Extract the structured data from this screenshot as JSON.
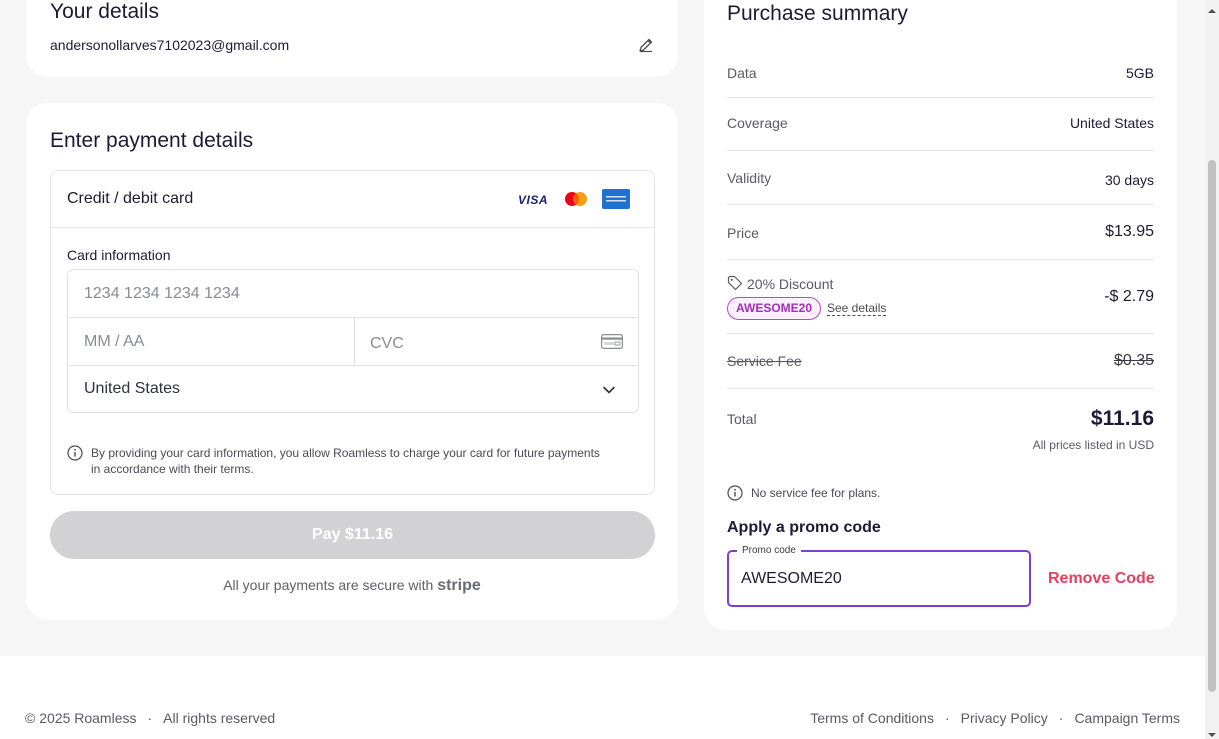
{
  "details": {
    "title": "Your details",
    "email": "andersonollarves7102023@gmail.com"
  },
  "payment": {
    "title": "Enter payment details",
    "method_label": "Credit / debit card",
    "card_brands": [
      "VISA",
      "mastercard",
      "amex"
    ],
    "card_info_label": "Card information",
    "card_number_placeholder": "1234 1234 1234 1234",
    "expiry_placeholder": "MM / AA",
    "cvc_placeholder": "CVC",
    "country_value": "United States",
    "consent_text": "By providing your card information, you allow Roamless to charge your card for future payments in accordance with their terms.",
    "pay_button_label": "Pay $11.16",
    "secure_text": "All your payments are secure with",
    "secure_brand": "stripe"
  },
  "summary": {
    "title": "Purchase summary",
    "rows": [
      {
        "label": "Data",
        "value": "5GB"
      },
      {
        "label": "Coverage",
        "value": "United States"
      },
      {
        "label": "Validity",
        "value": "30 days"
      },
      {
        "label": "Price",
        "value": "$13.95"
      }
    ],
    "discount_label": "20% Discount",
    "promo_badge": "AWESOME20",
    "see_details": "See details",
    "discount_value": "-$ 2.79",
    "service_fee_label": "Service Fee",
    "service_fee_value": "$0.35",
    "total_label": "Total",
    "total_value": "$11.16",
    "currency_note": "All prices listed in USD",
    "no_fee_note": "No service fee for plans.",
    "promo_title": "Apply a promo code",
    "promo_field_label": "Promo code",
    "promo_field_value": "AWESOME20",
    "remove_code_label": "Remove Code",
    "accent_color": "#7b3fd6",
    "remove_color": "#e5405e"
  },
  "footer": {
    "copyright": "© 2025 Roamless",
    "rights": "All rights reserved",
    "links": [
      "Terms of Conditions",
      "Privacy Policy",
      "Campaign Terms"
    ]
  }
}
